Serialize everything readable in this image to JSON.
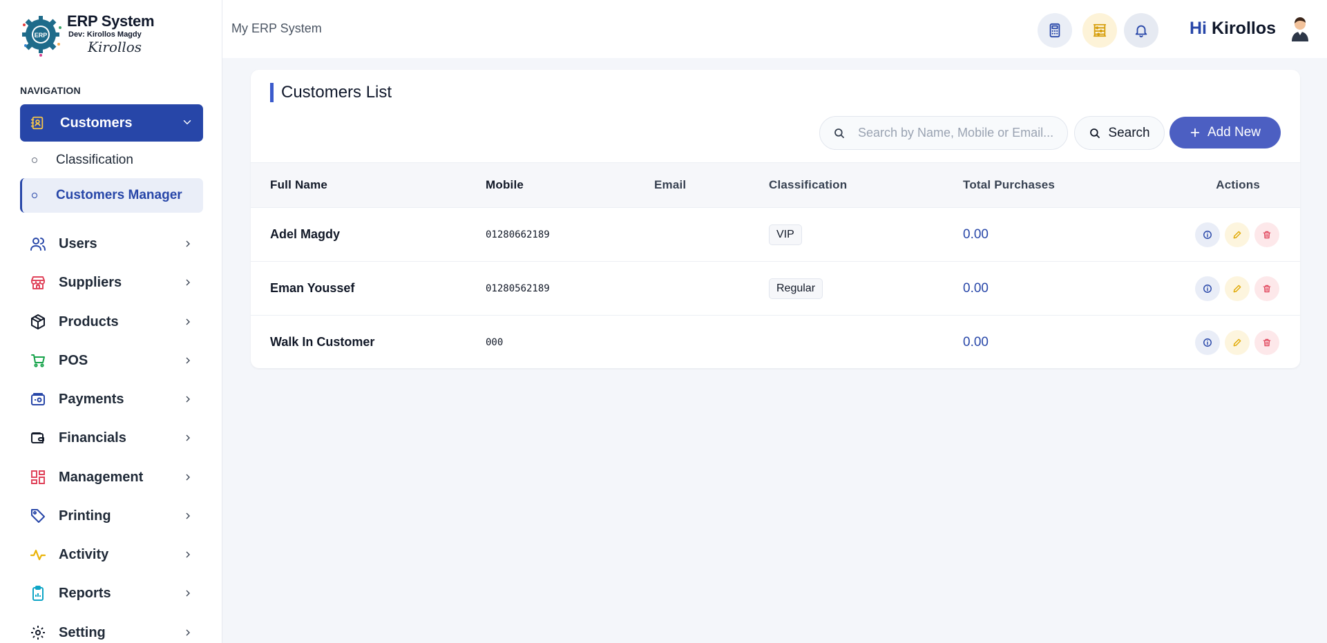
{
  "app": {
    "logo_title": "ERP System",
    "logo_dev": "Dev: Kirollos Magdy",
    "logo_signature": "Kirollos",
    "logo_badge": "ERP"
  },
  "sidebar": {
    "heading": "NAVIGATION",
    "active_section": {
      "label": "Customers",
      "icon": "contact-book-icon"
    },
    "sub_items": [
      {
        "label": "Classification",
        "active": false
      },
      {
        "label": "Customers Manager",
        "active": true
      }
    ],
    "items": [
      {
        "label": "Users",
        "icon": "users-icon",
        "color": "#2746a8"
      },
      {
        "label": "Suppliers",
        "icon": "store-icon",
        "color": "#e0435a"
      },
      {
        "label": "Products",
        "icon": "box-icon",
        "color": "#111827"
      },
      {
        "label": "POS",
        "icon": "cart-icon",
        "color": "#16a34a"
      },
      {
        "label": "Payments",
        "icon": "wallet-card-icon",
        "color": "#2746a8"
      },
      {
        "label": "Financials",
        "icon": "wallet-icon",
        "color": "#111827"
      },
      {
        "label": "Management",
        "icon": "grid-icon",
        "color": "#e0435a"
      },
      {
        "label": "Printing",
        "icon": "tag-icon",
        "color": "#2746a8"
      },
      {
        "label": "Activity",
        "icon": "pulse-icon",
        "color": "#eab308"
      },
      {
        "label": "Reports",
        "icon": "clipboard-icon",
        "color": "#0ea5c6"
      },
      {
        "label": "Setting",
        "icon": "gear-icon",
        "color": "#111827"
      }
    ]
  },
  "topbar": {
    "breadcrumb": "My ERP System",
    "greeting_hi": "Hi",
    "greeting_name": "Kirollos"
  },
  "customers": {
    "title": "Customers List",
    "search_placeholder": "Search by Name, Mobile or Email...",
    "search_value": "",
    "search_button": "Search",
    "add_button": "Add New",
    "columns": [
      "Full Name",
      "Mobile",
      "Email",
      "Classification",
      "Total Purchases",
      "Actions"
    ],
    "rows": [
      {
        "name": "Adel Magdy",
        "mobile": "01280662189",
        "email": "",
        "classification": "VIP",
        "total": "0.00"
      },
      {
        "name": "Eman Youssef",
        "mobile": "01280562189",
        "email": "",
        "classification": "Regular",
        "total": "0.00"
      },
      {
        "name": "Walk In Customer",
        "mobile": "000",
        "email": "",
        "classification": "",
        "total": "0.00"
      }
    ]
  }
}
